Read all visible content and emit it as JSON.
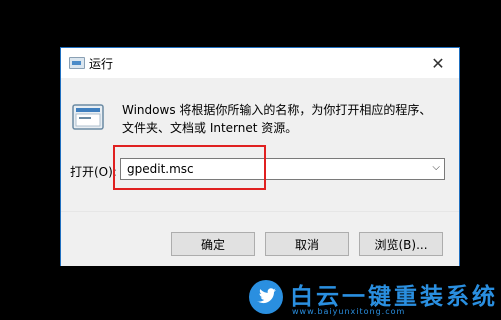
{
  "dialog": {
    "title": "运行",
    "description_line1": "Windows 将根据你所输入的名称，为你打开相应的程序、",
    "description_line2": "文件夹、文档或 Internet 资源。",
    "open_label": "打开(O):",
    "input_value": "gpedit.msc",
    "buttons": {
      "ok": "确定",
      "cancel": "取消",
      "browse": "浏览(B)..."
    },
    "close_glyph": "✕",
    "dropdown_glyph": "⌵"
  },
  "annotation": {
    "highlight_color": "#e02020"
  },
  "watermark": {
    "title": "白云一键重装系统",
    "url": "www.baiyunxitong.com",
    "color": "#2a8fe0"
  },
  "icons": [
    "run-app-icon",
    "run-dialog-icon",
    "close-icon",
    "chevron-down-icon",
    "twitter-bird-icon"
  ]
}
